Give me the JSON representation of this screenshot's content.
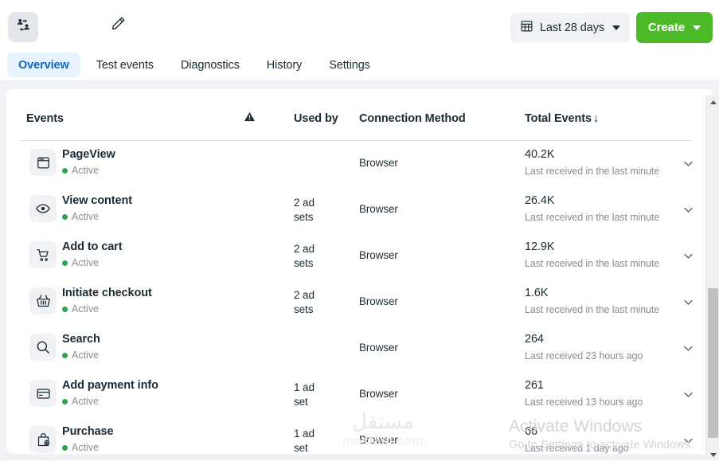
{
  "topbar": {
    "audience_icon": "people-sync-icon",
    "edit_icon": "pencil-icon",
    "date_picker": {
      "icon": "calendar-grid-icon",
      "label": "Last 28 days",
      "caret": "chevron-down-icon"
    },
    "create_button": {
      "label": "Create",
      "caret": "chevron-down-icon",
      "color": "#4dbb28"
    }
  },
  "tabs": {
    "active": "Overview",
    "active_bg": "#e7f3ff",
    "active_color": "#0a66c2",
    "items": [
      {
        "label": "Overview"
      },
      {
        "label": "Test events"
      },
      {
        "label": "Diagnostics"
      },
      {
        "label": "History"
      },
      {
        "label": "Settings"
      }
    ]
  },
  "table": {
    "columns": {
      "events": "Events",
      "warning_icon": "warning-triangle-icon",
      "used_by": "Used by",
      "connection_method": "Connection Method",
      "total_events": "Total Events",
      "sort_arrow": "↓"
    },
    "status_dot_color": "#31a24c",
    "rows": [
      {
        "icon": "browser-window-icon",
        "name": "PageView",
        "status": "Active",
        "used_by": "",
        "connection_method": "Browser",
        "total_events": "40.2K",
        "last_received": "Last received in the last minute",
        "expand_icon": "chevron-down-icon"
      },
      {
        "icon": "eye-icon",
        "name": "View content",
        "status": "Active",
        "used_by": "2 ad sets",
        "connection_method": "Browser",
        "total_events": "26.4K",
        "last_received": "Last received in the last minute",
        "expand_icon": "chevron-down-icon"
      },
      {
        "icon": "shopping-cart-icon",
        "name": "Add to cart",
        "status": "Active",
        "used_by": "2 ad sets",
        "connection_method": "Browser",
        "total_events": "12.9K",
        "last_received": "Last received in the last minute",
        "expand_icon": "chevron-down-icon"
      },
      {
        "icon": "shopping-basket-icon",
        "name": "Initiate checkout",
        "status": "Active",
        "used_by": "2 ad sets",
        "connection_method": "Browser",
        "total_events": "1.6K",
        "last_received": "Last received in the last minute",
        "expand_icon": "chevron-down-icon"
      },
      {
        "icon": "search-icon",
        "name": "Search",
        "status": "Active",
        "used_by": "",
        "connection_method": "Browser",
        "total_events": "264",
        "last_received": "Last received 23 hours ago",
        "expand_icon": "chevron-down-icon"
      },
      {
        "icon": "credit-card-icon",
        "name": "Add payment info",
        "status": "Active",
        "used_by": "1 ad set",
        "connection_method": "Browser",
        "total_events": "261",
        "last_received": "Last received 13 hours ago",
        "expand_icon": "chevron-down-icon"
      },
      {
        "icon": "shopping-bag-icon",
        "name": "Purchase",
        "status": "Active",
        "used_by": "1 ad set",
        "connection_method": "Browser",
        "total_events": "66",
        "last_received": "Last received 1 day ago",
        "expand_icon": "chevron-down-icon"
      }
    ]
  },
  "scrollbar": {
    "up_arrow": "scroll-up-arrow-icon",
    "down_arrow": "scroll-down-arrow-icon"
  },
  "watermarks": {
    "mostaql_arabic": "مستقل",
    "mostaql_latin": "mostaql.com",
    "windows_line1": "Activate Windows",
    "windows_line2": "Go to Settings to activate Windows."
  }
}
